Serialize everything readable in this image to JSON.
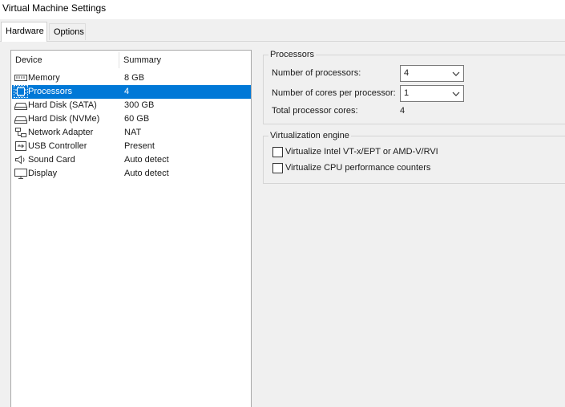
{
  "window": {
    "title": "Virtual Machine Settings"
  },
  "tabs": [
    {
      "label": "Hardware",
      "active": true
    },
    {
      "label": "Options",
      "active": false
    }
  ],
  "device_list": {
    "columns": {
      "device": "Device",
      "summary": "Summary"
    },
    "rows": [
      {
        "icon": "memory-icon",
        "device": "Memory",
        "summary": "8 GB",
        "selected": false
      },
      {
        "icon": "processor-icon",
        "device": "Processors",
        "summary": "4",
        "selected": true
      },
      {
        "icon": "hard-disk-icon",
        "device": "Hard Disk (SATA)",
        "summary": "300 GB",
        "selected": false
      },
      {
        "icon": "hard-disk-icon",
        "device": "Hard Disk (NVMe)",
        "summary": "60 GB",
        "selected": false
      },
      {
        "icon": "network-adapter-icon",
        "device": "Network Adapter",
        "summary": "NAT",
        "selected": false
      },
      {
        "icon": "usb-icon",
        "device": "USB Controller",
        "summary": "Present",
        "selected": false
      },
      {
        "icon": "speaker-icon",
        "device": "Sound Card",
        "summary": "Auto detect",
        "selected": false
      },
      {
        "icon": "display-icon",
        "device": "Display",
        "summary": "Auto detect",
        "selected": false
      }
    ]
  },
  "processors": {
    "legend": "Processors",
    "num_processors_label": "Number of processors:",
    "num_processors_value": "4",
    "cores_label": "Number of cores per processor:",
    "cores_value": "1",
    "total_label": "Total processor cores:",
    "total_value": "4"
  },
  "virtualization": {
    "legend": "Virtualization engine",
    "option1": {
      "label": "Virtualize Intel VT-x/EPT or AMD-V/RVI",
      "checked": false
    },
    "option2": {
      "label": "Virtualize CPU performance counters",
      "checked": false
    }
  },
  "colors": {
    "selection": "#0078d7",
    "panel_bg": "#f0f0f0"
  }
}
